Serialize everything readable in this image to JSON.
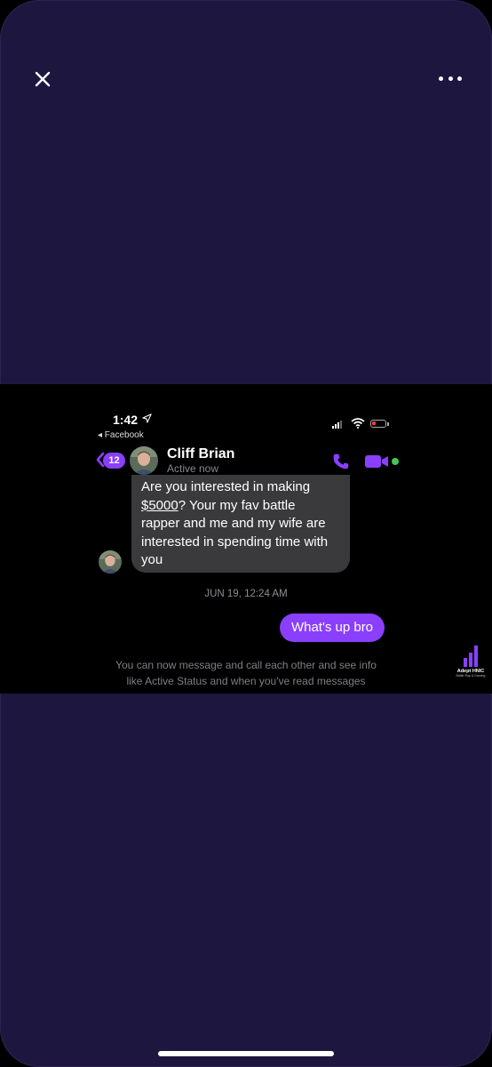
{
  "viewer": {
    "close_icon": "close-icon",
    "more_icon": "more-horizontal-icon"
  },
  "screenshot": {
    "status_bar": {
      "time": "1:42",
      "back_app": "◂ Facebook"
    },
    "header": {
      "unread_count": "12",
      "contact_name": "Cliff Brian",
      "status": "Active now"
    },
    "messages": {
      "incoming": {
        "text_before": "Are you interested in making\n",
        "money": "$5000",
        "text_after": "? Your my fav battle\nrapper and me and my wife are\ninterested in spending time with\nyou"
      },
      "timestamp": "JUN 19, 12:24 AM",
      "outgoing": "What's up bro",
      "system_note": "You can now message and call each other and see info\nlike Active Status and when you've read messages"
    },
    "watermark": {
      "name": "Adept HNIC",
      "subtitle": "Battle Rap & Gaming"
    }
  },
  "colors": {
    "viewer_background": "#1d1740",
    "accent": "#8a3ffc",
    "incoming_bubble": "#3a3a3c",
    "online": "#44c45c"
  }
}
